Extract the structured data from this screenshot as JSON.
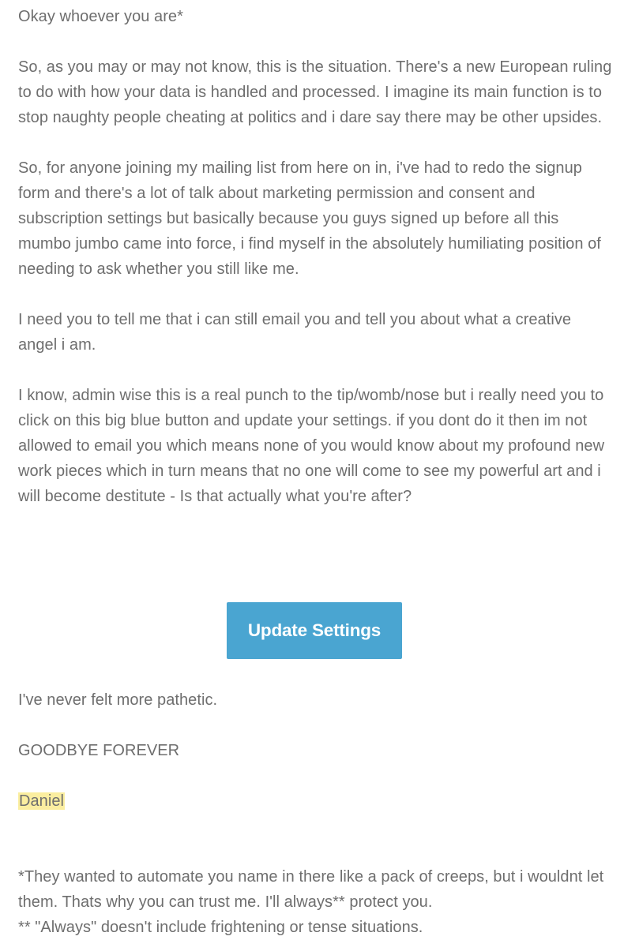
{
  "email": {
    "greeting": "Okay whoever you are*",
    "paragraph_1": "So, as you may or may not know, this is the situation. There's a new European ruling to do with how your data is handled and processed. I imagine its main function is to stop naughty people cheating at politics and i dare say there may be other upsides.",
    "paragraph_2": "So, for anyone joining my mailing list from here on in, i've had to redo the signup form and there's a lot of talk about marketing permission and consent and subscription settings but basically because you guys signed up before all this mumbo jumbo came into force, i find myself in the absolutely humiliating position of needing to ask whether you still like me.",
    "paragraph_3": "I need you to tell me that i can still email you and tell you about what a creative angel i am.",
    "paragraph_4": "I know, admin wise this is a real punch to the tip/womb/nose but i really need you to click on this big blue button and update your settings. if you dont do it then im not allowed to email you which means none of you would know about my profound new work pieces which in turn means that no one will come to see my powerful art and i will become destitute - Is that actually what you're after?",
    "button_label": "Update Settings",
    "pathetic_line": "I've never felt more pathetic.",
    "goodbye_line": "GOODBYE FOREVER",
    "signature": "Daniel",
    "footnote_1": "*They wanted to automate you name in there like a pack of creeps, but i wouldnt let them. Thats why you can trust me. I'll always** protect you.",
    "footnote_2": "** \"Always\" doesn't include frightening or tense situations."
  },
  "colors": {
    "text": "#6e6e6e",
    "button_bg": "#4aa5d1",
    "button_text": "#ffffff",
    "highlight": "#fbeea0"
  }
}
